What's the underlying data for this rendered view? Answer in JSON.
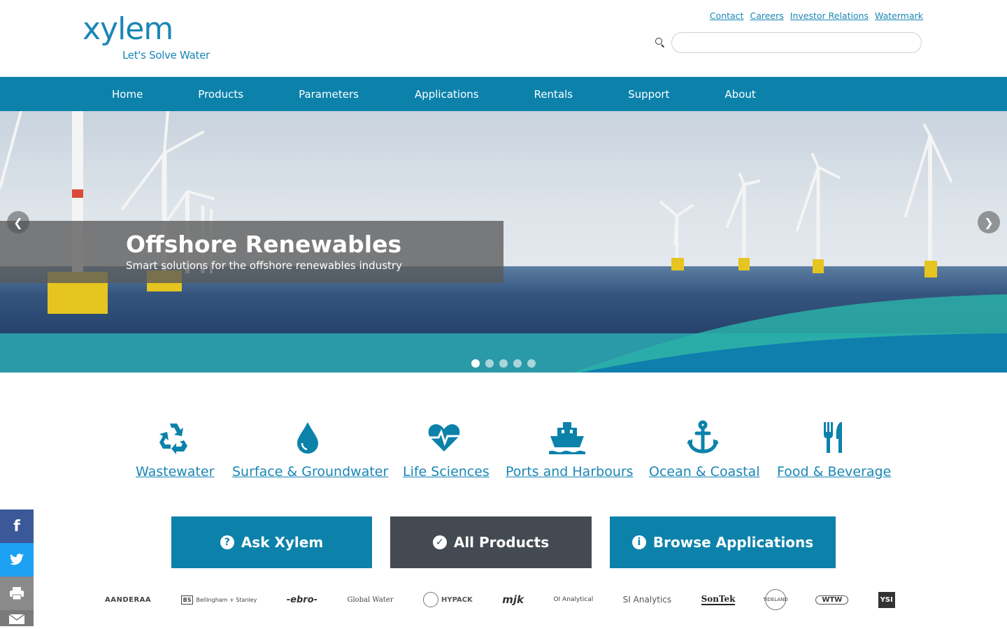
{
  "header": {
    "logo_word": "xylem",
    "logo_tagline": "Let's Solve Water",
    "top_links": [
      "Contact",
      "Careers",
      "Investor Relations",
      "Watermark"
    ],
    "search": {
      "value": "",
      "placeholder": ""
    }
  },
  "nav": {
    "items": [
      "Home",
      "Products",
      "Parameters",
      "Applications",
      "Rentals",
      "Support",
      "About"
    ]
  },
  "hero": {
    "title": "Offshore Renewables",
    "subtitle": "Smart solutions for the offshore renewables industry",
    "slide_count": 5,
    "active_slide": 1
  },
  "categories": [
    {
      "label": "Wastewater",
      "icon": "recycle-icon"
    },
    {
      "label": "Surface & Groundwater",
      "icon": "water-drop-icon"
    },
    {
      "label": "Life Sciences",
      "icon": "heartbeat-icon"
    },
    {
      "label": "Ports and Harbours",
      "icon": "ship-icon"
    },
    {
      "label": "Ocean & Coastal",
      "icon": "anchor-icon"
    },
    {
      "label": "Food & Beverage",
      "icon": "utensils-icon"
    }
  ],
  "actions": {
    "ask": "Ask Xylem",
    "products": "All Products",
    "browse": "Browse Applications"
  },
  "brands": [
    "AANDERAA",
    "Bellingham + Stanley",
    "-ebro-",
    "Global Water",
    "HYPACK",
    "mjk",
    "OI Analytical",
    "SI Analytics",
    "SonTek",
    "TIDELAND",
    "WTW",
    "YSI"
  ],
  "colors": {
    "brand_blue": "#0c82ab",
    "dark_button": "#444a52",
    "link_blue": "#1a86b5"
  }
}
